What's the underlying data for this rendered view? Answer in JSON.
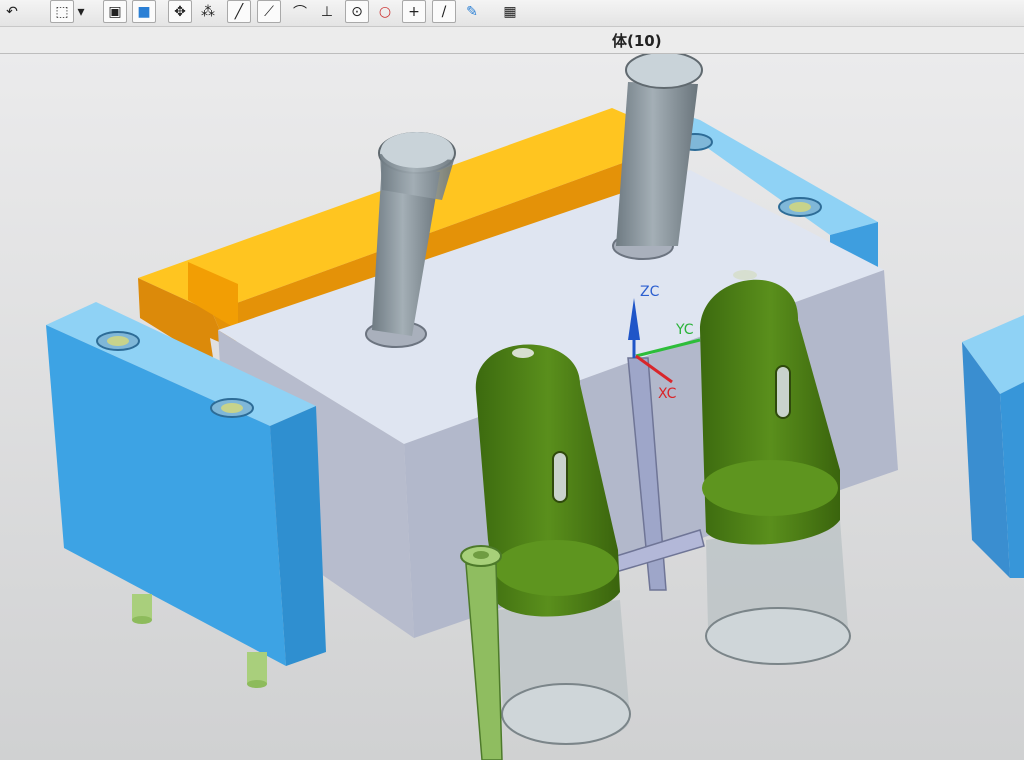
{
  "toolbar": {
    "items": [
      {
        "name": "rotate-icon",
        "glyph": "↶"
      },
      {
        "name": "select-box-icon",
        "glyph": "⬚"
      },
      {
        "name": "dropdown-arrow-icon",
        "glyph": "▾"
      },
      {
        "name": "shaded-view-icon",
        "glyph": "▣"
      },
      {
        "name": "solid-cube-icon",
        "glyph": "■"
      },
      {
        "name": "snap-grid-icon",
        "glyph": "✥"
      },
      {
        "name": "snap-points-icon",
        "glyph": "⁂"
      },
      {
        "name": "line-icon",
        "glyph": "╱"
      },
      {
        "name": "diagonal-line-icon",
        "glyph": "⟋"
      },
      {
        "name": "arc-icon",
        "glyph": "⌒"
      },
      {
        "name": "tangent-icon",
        "glyph": "⊥"
      },
      {
        "name": "center-point-icon",
        "glyph": "⊙"
      },
      {
        "name": "circle-icon",
        "glyph": "○"
      },
      {
        "name": "crosshair-icon",
        "glyph": "+"
      },
      {
        "name": "slash-icon",
        "glyph": "/"
      },
      {
        "name": "edit-icon",
        "glyph": "✎"
      },
      {
        "name": "table-icon",
        "glyph": "▦"
      }
    ]
  },
  "status": {
    "selection_text": "体(10)"
  },
  "viewport": {
    "axis_labels": {
      "z": "ZC",
      "y": "YC",
      "x": "XC"
    },
    "colors": {
      "background": "#d8d9da",
      "plate_top": "#dfe5f1",
      "plate_side": "#b4bacd",
      "blue_block": "#45a6e2",
      "orange_rail": "#f5b000",
      "green_cavity": "#4d7f15",
      "pin_gray": "#8f9ba3",
      "z_axis": "#1f55c8",
      "y_axis": "#2dbd3a",
      "x_axis": "#d9262b"
    }
  }
}
